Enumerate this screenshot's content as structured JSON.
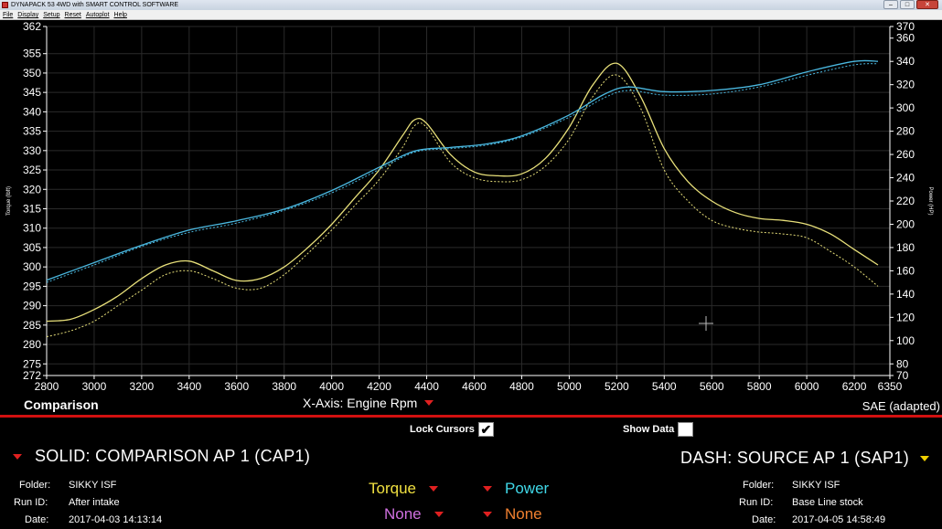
{
  "window": {
    "title": "DYNAPACK 53 4WD with SMART CONTROL SOFTWARE",
    "controls": {
      "minimize": "–",
      "maximize": "□",
      "close": "✕"
    }
  },
  "menu": [
    "File",
    "Display",
    "Setup",
    "Reset",
    "Autoplot",
    "Help"
  ],
  "chart_data": {
    "type": "line",
    "title": "",
    "xlabel": "Engine Rpm",
    "ylabel": "Torque (lbft)",
    "y2label": "Power (HP)",
    "xlim": [
      2800,
      6350
    ],
    "ylim": [
      272,
      362
    ],
    "y2lim": [
      70,
      370
    ],
    "xticks": [
      2800,
      3000,
      3200,
      3400,
      3600,
      3800,
      4000,
      4200,
      4400,
      4600,
      4800,
      5000,
      5200,
      5400,
      5600,
      5800,
      6000,
      6200,
      6350
    ],
    "yticks": [
      272,
      275,
      280,
      285,
      290,
      295,
      300,
      305,
      310,
      315,
      320,
      325,
      330,
      335,
      340,
      345,
      350,
      355,
      362
    ],
    "y2ticks": [
      70,
      80,
      100,
      120,
      140,
      160,
      180,
      200,
      220,
      240,
      260,
      280,
      300,
      320,
      340,
      360,
      370
    ],
    "grid": true,
    "colors": {
      "torque": "#e8e07a",
      "power": "#4ab8e0",
      "axis": "#ffffff",
      "grid": "#2a2a2a"
    },
    "series": [
      {
        "name": "Torque",
        "run": "SOLID",
        "axis": "left",
        "style": "solid",
        "x": [
          2800,
          2900,
          3000,
          3100,
          3200,
          3300,
          3400,
          3500,
          3600,
          3700,
          3800,
          3900,
          4000,
          4100,
          4200,
          4300,
          4350,
          4400,
          4500,
          4600,
          4700,
          4800,
          4900,
          5000,
          5100,
          5200,
          5300,
          5400,
          5500,
          5600,
          5700,
          5800,
          5900,
          6000,
          6100,
          6200,
          6300
        ],
        "y": [
          286,
          286.5,
          289,
          292.5,
          297,
          300.5,
          301.5,
          299,
          296.5,
          297,
          300,
          305,
          311,
          318,
          325,
          334,
          338,
          337,
          329,
          324.5,
          323.5,
          324,
          328,
          336,
          347,
          352.5,
          344,
          330.5,
          322,
          317,
          314,
          312.5,
          312,
          311,
          308.5,
          304.5,
          300.5
        ]
      },
      {
        "name": "Torque",
        "run": "DASH",
        "axis": "left",
        "style": "dash",
        "x": [
          2800,
          2900,
          3000,
          3100,
          3200,
          3300,
          3400,
          3500,
          3600,
          3700,
          3800,
          3900,
          4000,
          4100,
          4200,
          4300,
          4350,
          4400,
          4500,
          4600,
          4700,
          4800,
          4900,
          5000,
          5100,
          5200,
          5300,
          5400,
          5500,
          5600,
          5700,
          5800,
          5900,
          6000,
          6100,
          6200,
          6300
        ],
        "y": [
          282,
          283.5,
          286,
          290,
          294,
          298,
          299,
          297,
          294.5,
          294.5,
          298,
          303.5,
          309.5,
          316,
          322.5,
          331,
          336.5,
          336,
          327,
          323,
          322,
          322.5,
          326,
          333,
          344,
          349.5,
          341,
          325,
          317,
          312,
          310,
          309,
          308.5,
          307.5,
          304,
          300,
          295
        ]
      },
      {
        "name": "Power",
        "run": "SOLID",
        "axis": "right",
        "style": "solid",
        "x": [
          2800,
          3000,
          3200,
          3400,
          3600,
          3800,
          4000,
          4200,
          4350,
          4500,
          4650,
          4800,
          5000,
          5150,
          5250,
          5400,
          5600,
          5800,
          6000,
          6200,
          6300
        ],
        "y": [
          152,
          167,
          182,
          195,
          203,
          213,
          229,
          249,
          263,
          266,
          269,
          276,
          294,
          312,
          318,
          314,
          315,
          320,
          331,
          340,
          340
        ]
      },
      {
        "name": "Power",
        "run": "DASH",
        "axis": "right",
        "style": "dash",
        "x": [
          2800,
          3000,
          3200,
          3400,
          3600,
          3800,
          4000,
          4200,
          4350,
          4500,
          4650,
          4800,
          5000,
          5150,
          5250,
          5400,
          5600,
          5800,
          6000,
          6200,
          6300
        ],
        "y": [
          150,
          165,
          181,
          193,
          201,
          212,
          227,
          247,
          262,
          265,
          268,
          275,
          292,
          309,
          315,
          311,
          312,
          318,
          328,
          337,
          338
        ]
      }
    ]
  },
  "footer": {
    "chart_name": "Comparison",
    "xaxis_label": "X-Axis: Engine Rpm",
    "standard": "SAE (adapted)"
  },
  "panel": {
    "lock_cursors": {
      "label": "Lock Cursors",
      "checked": true,
      "check_glyph": "✔"
    },
    "show_data": {
      "label": "Show Data",
      "checked": false
    },
    "solid": {
      "label": "SOLID: COMPARISON AP 1 (CAP1)",
      "folder_label": "Folder:",
      "folder": "SIKKY ISF",
      "runid_label": "Run ID:",
      "runid": "After intake",
      "date_label": "Date:",
      "date": "2017-04-03 14:13:14"
    },
    "dash": {
      "label": "DASH: SOURCE AP 1 (SAP1)",
      "folder_label": "Folder:",
      "folder": "SIKKY ISF",
      "runid_label": "Run ID:",
      "runid": "Base Line stock",
      "date_label": "Date:",
      "date": "2017-04-05 14:58:49"
    },
    "channels": {
      "ch1": "Torque",
      "ch1_color": "#f0e040",
      "ch2": "Power",
      "ch2_color": "#40d8e8",
      "ch3": "None",
      "ch3_color": "#d070e0",
      "ch4": "None",
      "ch4_color": "#f08030"
    }
  }
}
